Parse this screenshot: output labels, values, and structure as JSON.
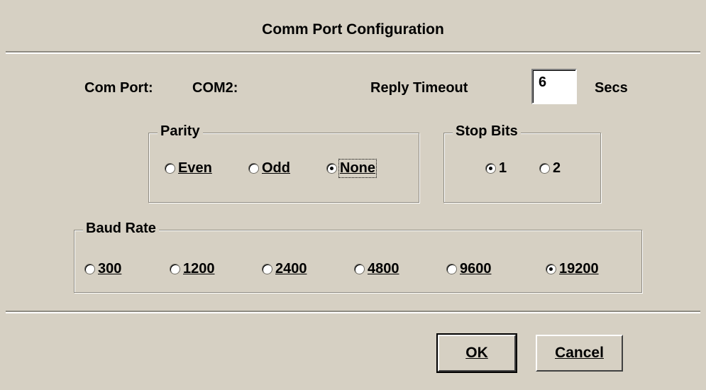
{
  "dialog": {
    "title": "Comm Port Configuration"
  },
  "com_port": {
    "label": "Com Port:",
    "value": "COM2:"
  },
  "reply_timeout": {
    "label": "Reply Timeout",
    "value": "6",
    "unit": "Secs"
  },
  "parity": {
    "title": "Parity",
    "options": [
      {
        "label": "Even",
        "selected": false
      },
      {
        "label": "Odd",
        "selected": false
      },
      {
        "label": "None",
        "selected": true
      }
    ]
  },
  "stop_bits": {
    "title": "Stop Bits",
    "options": [
      {
        "label": "1",
        "selected": true
      },
      {
        "label": "2",
        "selected": false
      }
    ]
  },
  "baud_rate": {
    "title": "Baud Rate",
    "options": [
      {
        "label": "300",
        "selected": false
      },
      {
        "label": "1200",
        "selected": false
      },
      {
        "label": "2400",
        "selected": false
      },
      {
        "label": "4800",
        "selected": false
      },
      {
        "label": "9600",
        "selected": false
      },
      {
        "label": "19200",
        "selected": true
      }
    ]
  },
  "buttons": {
    "ok": "OK",
    "cancel": "Cancel"
  }
}
